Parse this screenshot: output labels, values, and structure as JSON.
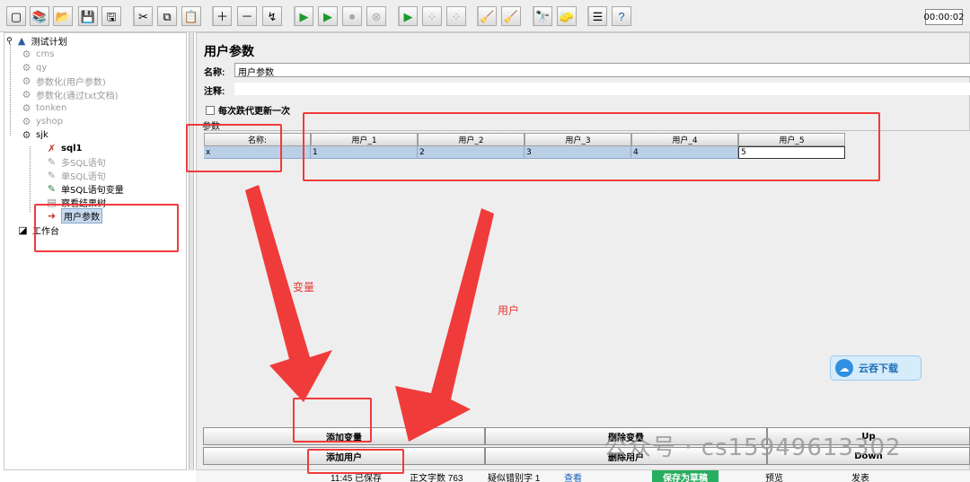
{
  "toolbar": {
    "timer": "00:00:02",
    "icons": [
      "new-icon",
      "templates-icon",
      "open-icon",
      "save-icon",
      "save-as-icon",
      "cut-icon",
      "copy-icon",
      "paste-icon",
      "expand-icon",
      "collapse-icon",
      "toggle-icon",
      "start-icon",
      "start-no-pause-icon",
      "stop-icon",
      "shutdown-icon",
      "remote-start-icon",
      "remote-stop-icon",
      "remote-exit-icon",
      "clear-icon",
      "clear-all-icon",
      "search-icon",
      "reset-search-icon",
      "function-helper-icon",
      "help-icon"
    ]
  },
  "tree": {
    "root": "测试计划",
    "items": [
      "cms",
      "qy",
      "参数化(用户参数)",
      "参数化(通过txt文档)",
      "tonken",
      "yshop"
    ],
    "sjk": "sjk",
    "children": [
      "sql1",
      "多SQL语句",
      "单SQL语句",
      "单SQL语句变量",
      "察看结果树",
      "用户参数"
    ],
    "workbench": "工作台"
  },
  "panel": {
    "title": "用户参数",
    "name_label": "名称:",
    "name_value": "用户参数",
    "comment_label": "注释:",
    "update_once_label": "每次跌代更新一次",
    "params_label": "参数"
  },
  "table": {
    "headers": [
      "名称:",
      "用户_1",
      "用户_2",
      "用户_3",
      "用户_4",
      "用户_5"
    ],
    "row": [
      "x",
      "1",
      "2",
      "3",
      "4",
      "5"
    ]
  },
  "buttons": {
    "add_variable": "添加变量",
    "delete_variable": "删除变量",
    "up": "Up",
    "add_user": "添加用户",
    "delete_user": "删除用户",
    "down": "Down"
  },
  "status": {
    "saved": "11:45 已保存",
    "word_count": "正文字数 763",
    "typo": "疑似错别字 1",
    "view": "查看",
    "save_draft": "保存为草稿",
    "preview": "预览",
    "publish": "发表"
  },
  "annotations": {
    "variable": "变量",
    "user": "用户"
  },
  "watermarks": {
    "badge": "云吞下载",
    "wechat": "公众号 · cs15949613302"
  },
  "colors": {
    "annotation_red": "#f03b3b",
    "selection_blue": "#b9cfe6",
    "status_green": "#27ae60"
  }
}
